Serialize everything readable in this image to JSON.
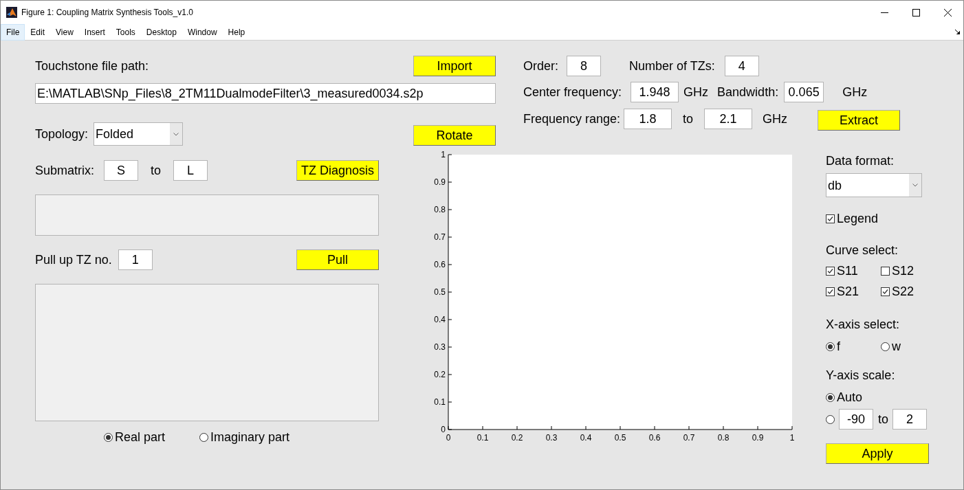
{
  "window": {
    "title": "Figure 1: Coupling Matrix Synthesis Tools_v1.0"
  },
  "menu": [
    {
      "label": "File",
      "selected": true
    },
    {
      "label": "Edit",
      "selected": false
    },
    {
      "label": "View",
      "selected": false
    },
    {
      "label": "Insert",
      "selected": false
    },
    {
      "label": "Tools",
      "selected": false
    },
    {
      "label": "Desktop",
      "selected": false
    },
    {
      "label": "Window",
      "selected": false
    },
    {
      "label": "Help",
      "selected": false
    }
  ],
  "file_panel": {
    "path_label": "Touchstone file path:",
    "import_button": "Import",
    "path_value": "E:\\MATLAB\\SNp_Files\\8_2TM11DualmodeFilter\\3_measured0034.s2p",
    "topology_label": "Topology:",
    "topology_value": "Folded",
    "rotate_button": "Rotate"
  },
  "params": {
    "order_label": "Order:",
    "order_value": "8",
    "tzs_label": "Number of TZs:",
    "tzs_value": "4",
    "center_label": "Center frequency:",
    "center_value": "1.948",
    "center_unit": "GHz",
    "bandwidth_label": "Bandwidth:",
    "bandwidth_value": "0.065",
    "bandwidth_unit": "GHz",
    "range_label": "Frequency range:",
    "range_from": "1.8",
    "range_to_label": "to",
    "range_to": "2.1",
    "range_unit": "GHz",
    "extract_button": "Extract"
  },
  "matrix_panel": {
    "submatrix_label": "Submatrix:",
    "submatrix_from": "S",
    "submatrix_to_label": "to",
    "submatrix_to": "L",
    "tz_diagnosis_button": "TZ Diagnosis",
    "pull_label": "Pull up TZ no.",
    "pull_value": "1",
    "pull_button": "Pull",
    "part_options": [
      {
        "label": "Real part",
        "selected": true
      },
      {
        "label": "Imaginary part",
        "selected": false
      }
    ]
  },
  "plot": {
    "chart_data": {
      "type": "line",
      "xlim": [
        0,
        1
      ],
      "ylim": [
        0,
        1
      ],
      "xticks": [
        0,
        0.1,
        0.2,
        0.3,
        0.4,
        0.5,
        0.6,
        0.7,
        0.8,
        0.9,
        1
      ],
      "yticks": [
        0,
        0.1,
        0.2,
        0.3,
        0.4,
        0.5,
        0.6,
        0.7,
        0.8,
        0.9,
        1
      ]
    }
  },
  "display_panel": {
    "data_format_label": "Data format:",
    "data_format_value": "db",
    "legend": {
      "label": "Legend",
      "checked": true
    },
    "curve_label": "Curve select:",
    "curves": [
      {
        "label": "S11",
        "checked": true
      },
      {
        "label": "S12",
        "checked": false
      },
      {
        "label": "S21",
        "checked": true
      },
      {
        "label": "S22",
        "checked": true
      }
    ],
    "xaxis_label": "X-axis select:",
    "xaxis_options": [
      {
        "label": "f",
        "selected": true
      },
      {
        "label": "w",
        "selected": false
      }
    ],
    "yscale_label": "Y-axis scale:",
    "yscale_auto": {
      "label": "Auto",
      "selected": true
    },
    "yscale_manual": {
      "selected": false,
      "from": "-90",
      "to_label": "to",
      "to": "2"
    },
    "apply_button": "Apply"
  }
}
